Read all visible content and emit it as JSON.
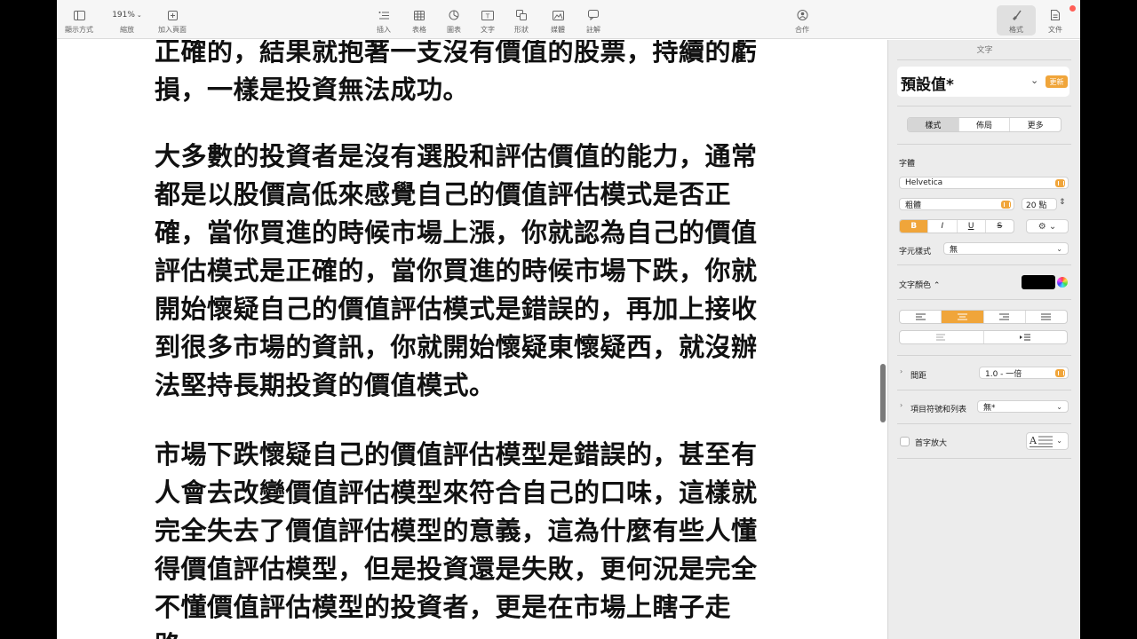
{
  "toolbar": {
    "view_label": "顯示方式",
    "zoom_value": "191%",
    "zoom_label": "縮放",
    "add_page_label": "加入頁面",
    "insert_label": "插入",
    "table_label": "表格",
    "chart_label": "圖表",
    "text_label": "文字",
    "shape_label": "形狀",
    "media_label": "媒體",
    "comment_label": "註解",
    "collaborate_label": "合作",
    "format_label": "格式",
    "document_label": "文件"
  },
  "document": {
    "paragraphs": [
      {
        "lines": [
          "正確的，結果就抱著一支沒有價值的股票，持續的虧",
          "損，一樣是投資無法成功。"
        ]
      },
      {
        "lines": [
          "大多數的投資者是沒有選股和評估價值的能力，通常",
          "都是以股價高低來感覺自己的價值評估模式是否正",
          "確，當你買進的時候市場上漲，你就認為自己的價值",
          "評估模式是正確的，當你買進的時候市場下跌，你就",
          "開始懷疑自己的價值評估模式是錯誤的，再加上接收",
          "到很多市場的資訊，你就開始懷疑東懷疑西，就沒辦",
          "法堅持長期投資的價值模式。"
        ]
      },
      {
        "lines": [
          "市場下跌懷疑自己的價值評估模型是錯誤的，甚至有",
          "人會去改變價值評估模型來符合自己的口味，這樣就",
          "完全失去了價值評估模型的意義，這為什麼有些人懂",
          "得價值評估模型，但是投資還是失敗，更何況是完全",
          "不懂價值評估模型的投資者，更是在市場上瞎子走",
          "路。"
        ]
      }
    ]
  },
  "inspector": {
    "header": "文字",
    "style_name": "預設值*",
    "update_label": "更新",
    "tabs": [
      "樣式",
      "佈局",
      "更多"
    ],
    "font_label": "字體",
    "font_family": "Helvetica",
    "font_weight": "粗體",
    "font_size": "20 點",
    "bold": "B",
    "italic": "I",
    "underline": "U",
    "strikethrough": "S",
    "char_style_label": "字元樣式",
    "char_style_value": "無",
    "text_color_label": "文字顏色 ⌃",
    "text_color": "#000000",
    "accent_color": "#f0a53a",
    "spacing_label": "間距",
    "spacing_value": "1.0 - 一倍",
    "bullets_label": "項目符號和列表",
    "bullets_value": "無*",
    "dropcap_label": "首字放大"
  }
}
